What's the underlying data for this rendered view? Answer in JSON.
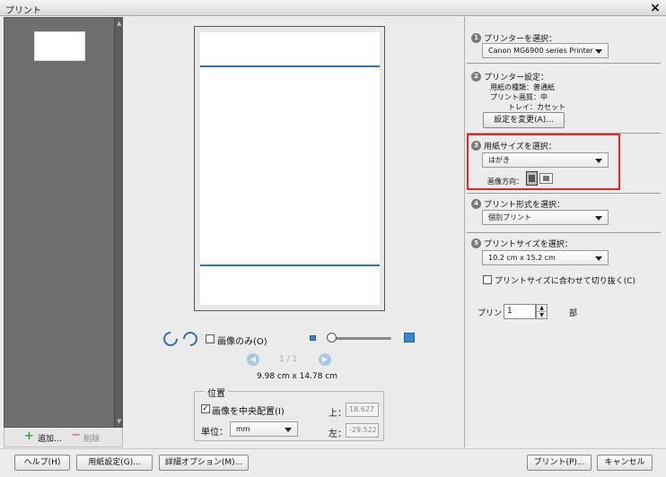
{
  "window": {
    "title": "プリント",
    "close_glyph": "×"
  },
  "left": {
    "add_label": "追加...",
    "remove_label": "削除"
  },
  "preview": {
    "image_only_label": "画像のみ(O)",
    "page_indicator": "1 / 1",
    "dimensions": "9.98 cm x 14.78 cm",
    "position": {
      "title": "位置",
      "center_label": "画像を中央配置(I)",
      "unit_label": "単位：",
      "unit_value": "mm",
      "top_label": "上：",
      "top_value": "18.627",
      "left_label": "左：",
      "left_value": "-29.522"
    }
  },
  "right": {
    "step1": {
      "num": "1",
      "header": "プリンターを選択：",
      "printer": "Canon MG6900 series Printer"
    },
    "step2": {
      "num": "2",
      "header": "プリンター設定：",
      "paper_type": "用紙の種類：普通紙",
      "quality": "プリント画質：中",
      "tray": "トレイ：カセット",
      "change_button": "設定を変更(A)..."
    },
    "step3": {
      "num": "3",
      "header": "用紙サイズを選択：",
      "paper_size": "はがき",
      "orientation_label": "画像方向："
    },
    "step4": {
      "num": "4",
      "header": "プリント形式を選択：",
      "format": "個別プリント"
    },
    "step5": {
      "num": "5",
      "header": "プリントサイズを選択：",
      "size": "10.2 cm x 15.2 cm",
      "crop_label": "プリントサイズに合わせて切り抜く(C)"
    },
    "copies": {
      "label": "プリント",
      "value": "1",
      "unit": "部"
    }
  },
  "footer": {
    "help": "ヘルプ(H)",
    "page_setup": "用紙設定(G)...",
    "more_options": "詳細オプション(M)...",
    "print": "プリント(P)...",
    "cancel": "キャンセル"
  },
  "colors": {
    "accent": "#2e72b8",
    "highlight": "#e02828"
  }
}
